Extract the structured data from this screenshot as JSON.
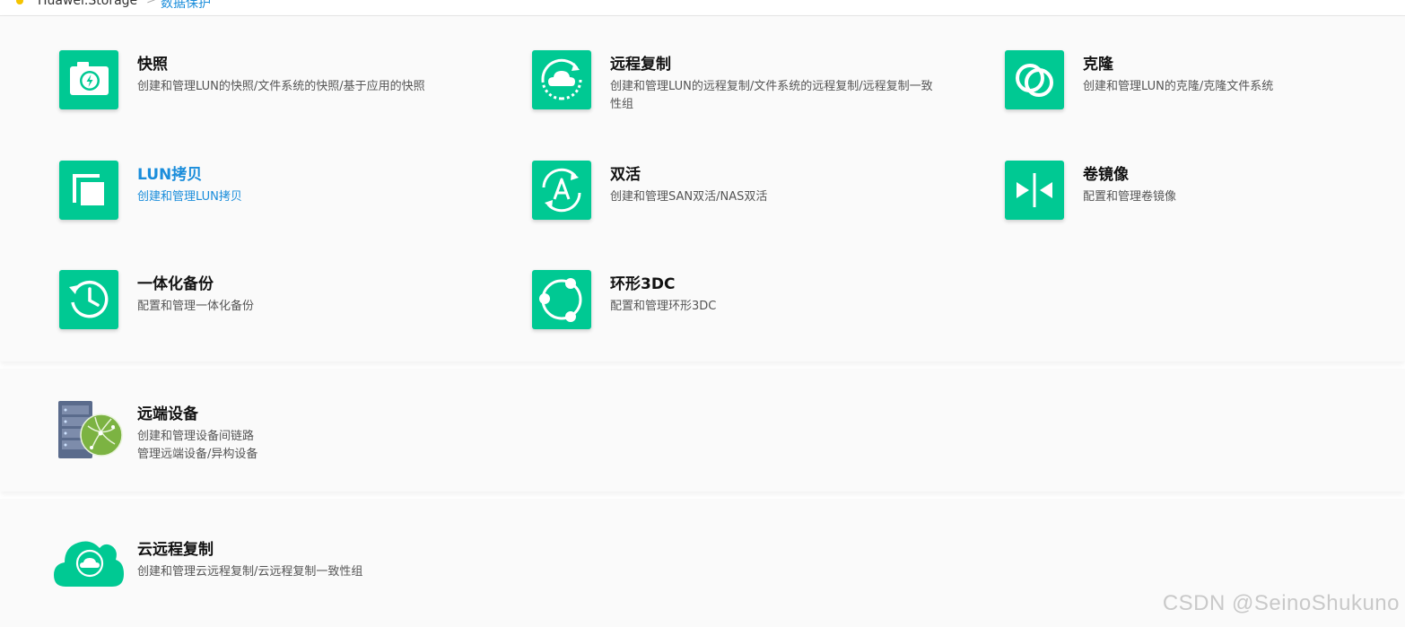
{
  "breadcrumb": {
    "root": "Huawei.Storage",
    "separator": ">",
    "current": "数据保护"
  },
  "features": {
    "snapshot": {
      "title": "快照",
      "desc": "创建和管理LUN的快照/文件系统的快照/基于应用的快照"
    },
    "remote_replication": {
      "title": "远程复制",
      "desc": "创建和管理LUN的远程复制/文件系统的远程复制/远程复制一致性组"
    },
    "clone": {
      "title": "克隆",
      "desc": "创建和管理LUN的克隆/克隆文件系统"
    },
    "lun_copy": {
      "title": "LUN拷贝",
      "desc": "创建和管理LUN拷贝"
    },
    "hypermetro": {
      "title": "双活",
      "desc": "创建和管理SAN双活/NAS双活"
    },
    "volume_mirror": {
      "title": "卷镜像",
      "desc": "配置和管理卷镜像"
    },
    "integrated_backup": {
      "title": "一体化备份",
      "desc": "配置和管理一体化备份"
    },
    "ring_3dc": {
      "title": "环形3DC",
      "desc": "配置和管理环形3DC"
    }
  },
  "remote_device": {
    "title": "远端设备",
    "desc_line1": "创建和管理设备间链路",
    "desc_line2": "管理远端设备/异构设备"
  },
  "cloud_replication": {
    "title": "云远程复制",
    "desc": "创建和管理云远程复制/云远程复制一致性组"
  },
  "watermark": "CSDN @SeinoShukuno",
  "colors": {
    "tile_green": "#00c993",
    "link_blue": "#1a8ddb",
    "globe_green": "#7cb342"
  },
  "icons": {
    "snapshot": "camera-icon",
    "remote_replication": "cloud-sync-icon",
    "clone": "clone-rings-icon",
    "lun_copy": "copy-icon",
    "hypermetro": "active-active-icon",
    "volume_mirror": "mirror-icon",
    "integrated_backup": "clock-backup-icon",
    "ring_3dc": "ring-3dc-icon",
    "remote_device": "server-globe-icon",
    "cloud_replication": "cloud-replication-icon"
  }
}
